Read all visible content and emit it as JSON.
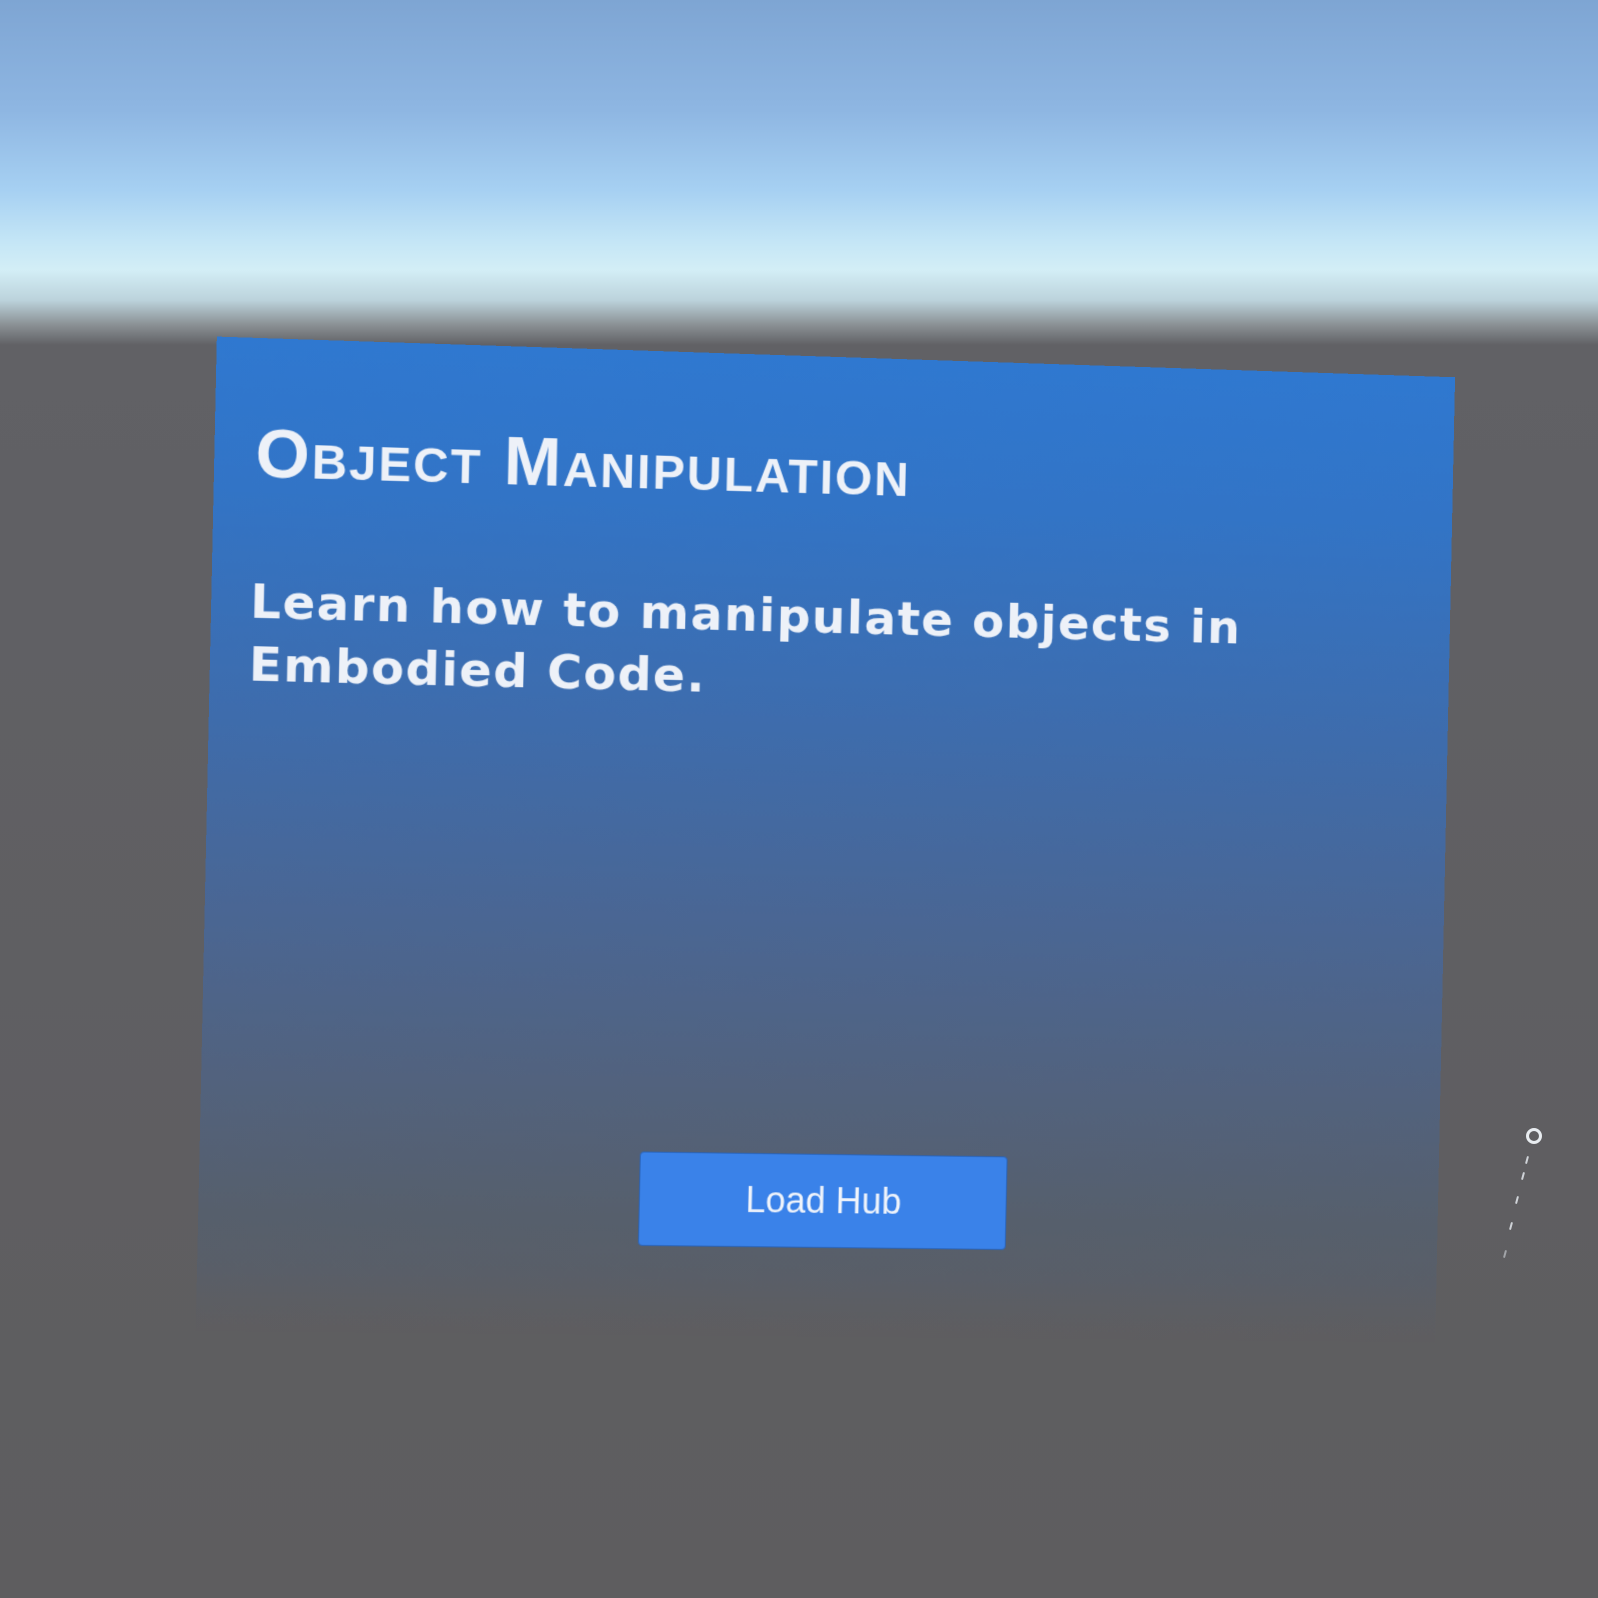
{
  "panel": {
    "title": "Object Manipulation",
    "description": "Learn how to manipulate objects in Embodied Code.",
    "load_hub_label": "Load Hub"
  },
  "icons": {
    "controller_pointer": "controller-pointer-icon"
  },
  "colors": {
    "panel_top": "#2f78d0",
    "panel_bottom": "#5c5e64",
    "button": "#3a82e9",
    "text": "#edf1f8",
    "ground": "#5e5d5f",
    "sky_top": "#7ea5d3",
    "horizon": "#d3eef6"
  }
}
